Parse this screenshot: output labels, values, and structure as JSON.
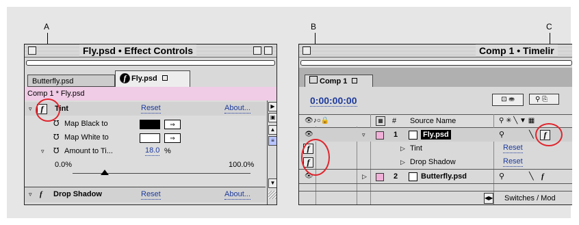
{
  "callouts": {
    "a": "A",
    "b": "B",
    "c": "C"
  },
  "effect_controls": {
    "title": "Fly.psd • Effect Controls",
    "tabs": [
      {
        "label": "Butterfly.psd"
      },
      {
        "label": "Fly.psd"
      }
    ],
    "breadcrumb": "Comp 1 * Fly.psd",
    "tint": {
      "name": "Tint",
      "reset": "Reset",
      "about": "About..."
    },
    "props": [
      {
        "label": "Map Black to"
      },
      {
        "label": "Map White to"
      },
      {
        "label": "Amount to Ti...",
        "value": "18.0",
        "unit": "%"
      }
    ],
    "slider": {
      "min": "0.0%",
      "max": "100.0%",
      "value": 0.18
    },
    "drop_shadow": {
      "name": "Drop Shadow",
      "reset": "Reset",
      "about": "About..."
    },
    "colors": {
      "pink_bar": "#f0cce6",
      "black": "#000000",
      "white": "#ffffff"
    }
  },
  "timeline": {
    "title": "Comp 1 • Timelir",
    "tab": "Comp 1",
    "timecode": "0:00:00:00",
    "headers": {
      "num": "#",
      "source": "Source Name"
    },
    "layers": [
      {
        "num": "1",
        "name": "Fly.psd",
        "color": "#f0b0d8"
      },
      {
        "num": "2",
        "name": "Butterfly.psd",
        "color": "#f0b0d8"
      }
    ],
    "effects": [
      {
        "name": "Tint",
        "reset": "Reset"
      },
      {
        "name": "Drop Shadow",
        "reset": "Reset"
      }
    ],
    "footer": "Switches / Mod"
  }
}
